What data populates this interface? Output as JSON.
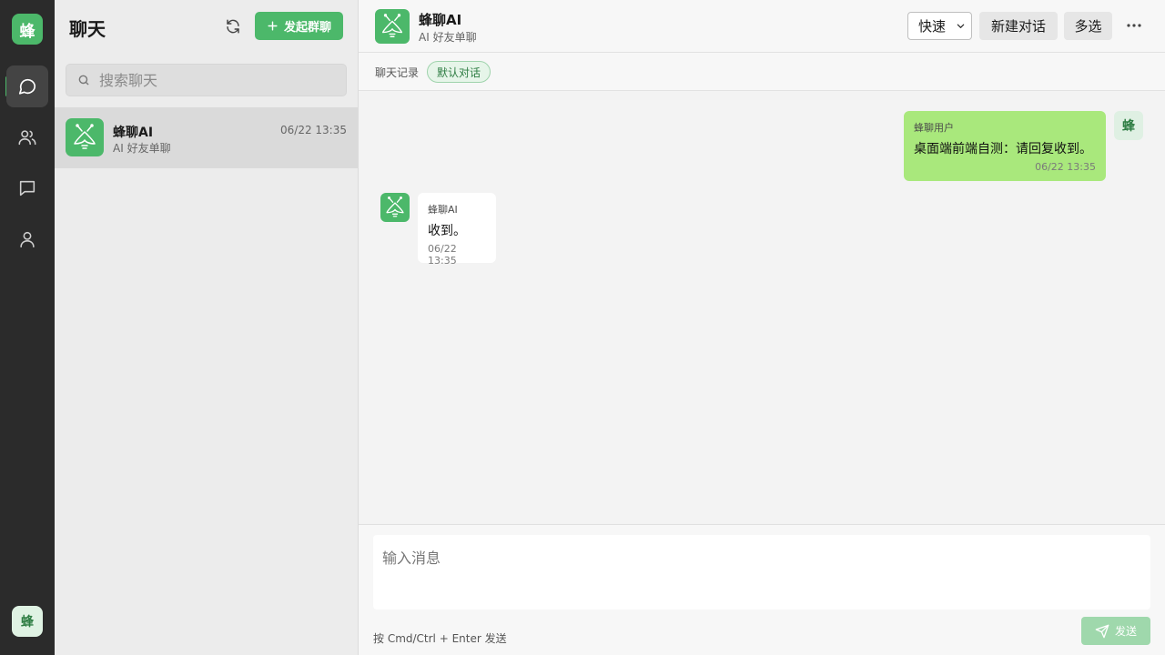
{
  "rail": {
    "logo_text": "蜂",
    "items": [
      {
        "name": "chat",
        "icon": "chat-bubble-icon",
        "active": true
      },
      {
        "name": "contacts",
        "icon": "users-icon",
        "active": false
      },
      {
        "name": "messages",
        "icon": "message-square-icon",
        "active": false
      },
      {
        "name": "profile",
        "icon": "user-icon",
        "active": false
      }
    ],
    "avatar_text": "蜂"
  },
  "sidebar": {
    "title": "聊天",
    "refresh_icon": "refresh-icon",
    "new_group_label": "发起群聊",
    "search_placeholder": "搜索聊天",
    "conversations": [
      {
        "name": "蜂聊AI",
        "subtitle": "AI 好友单聊",
        "time": "06/22 13:35",
        "selected": true
      }
    ]
  },
  "chat": {
    "title": "蜂聊AI",
    "subtitle": "AI 好友单聊",
    "mode_value": "快速",
    "new_chat_label": "新建对话",
    "multiselect_label": "多选",
    "more_icon": "more-horizontal-icon",
    "history_label": "聊天记录",
    "history_chip": "默认对话",
    "messages": [
      {
        "direction": "out",
        "sender": "蜂聊用户",
        "text": "桌面端前端自测：请回复收到。",
        "time": "06/22 13:35",
        "avatar_text": "蜂"
      },
      {
        "direction": "in",
        "sender": "蜂聊AI",
        "text": "收到。",
        "time": "06/22 13:35"
      }
    ]
  },
  "composer": {
    "placeholder": "输入消息",
    "hint": "按 Cmd/Ctrl + Enter 发送",
    "send_label": "发送"
  },
  "colors": {
    "accent": "#4cb86a",
    "rail_bg": "#2b2b2b",
    "outgoing_bubble": "#a9e87c",
    "send_disabled": "#9fd8ac"
  }
}
